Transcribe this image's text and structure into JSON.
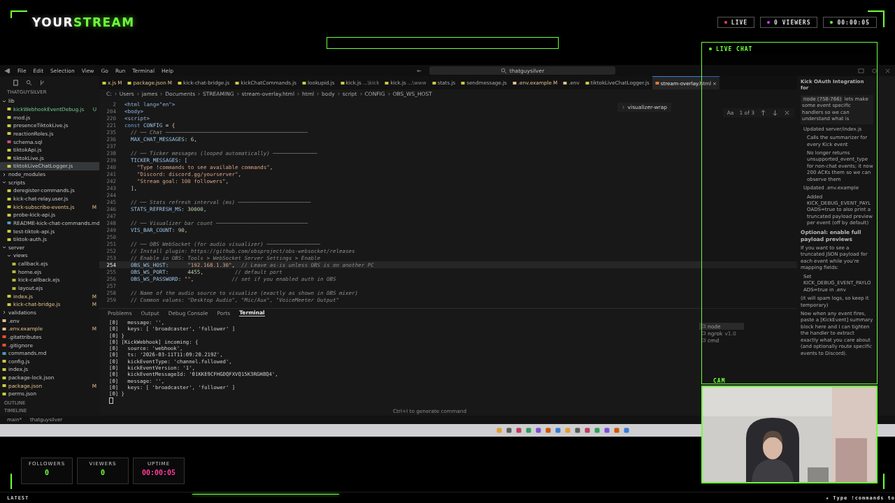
{
  "logo": {
    "parts": [
      {
        "text": "YOUR",
        "accent": false
      },
      {
        "text": "STREAM",
        "accent": true
      }
    ]
  },
  "status_pills": [
    {
      "label": "LIVE",
      "color": "#ff3b5c"
    },
    {
      "label": "0  VIEWERS",
      "color": "#d63cff"
    },
    {
      "label": "00:00:05",
      "color": "#6dff3a"
    }
  ],
  "editor": {
    "menu": [
      "File",
      "Edit",
      "Selection",
      "View",
      "Go",
      "Run",
      "Terminal",
      "Help"
    ],
    "command_center": "thatguysilver",
    "explorer_title": "THATGUYSILVER",
    "tree": [
      {
        "name": "lib",
        "kind": "folder",
        "expanded": true,
        "selected": false,
        "children": [
          {
            "name": "kickWebhookEventDebug.js",
            "kind": "js",
            "badge": "U",
            "modified": false,
            "selected": false
          },
          {
            "name": "mod.js",
            "kind": "js",
            "selected": false
          },
          {
            "name": "presenceTiktokLive.js",
            "kind": "js",
            "selected": false
          },
          {
            "name": "reactionRoles.js",
            "kind": "js",
            "selected": false
          },
          {
            "name": "schema.sql",
            "kind": "sql",
            "selected": false
          },
          {
            "name": "tiktokApi.js",
            "kind": "js",
            "selected": false
          },
          {
            "name": "tiktokLive.js",
            "kind": "js",
            "selected": false
          },
          {
            "name": "tiktokLiveChatLogger.js",
            "kind": "js",
            "selected": true
          }
        ]
      },
      {
        "name": "node_modules",
        "kind": "folder",
        "expanded": false,
        "selected": false
      },
      {
        "name": "scripts",
        "kind": "folder",
        "expanded": true,
        "selected": false,
        "children": [
          {
            "name": "deregister-commands.js",
            "kind": "js",
            "selected": false
          },
          {
            "name": "kick-chat-relay.user.js",
            "kind": "js",
            "selected": false
          },
          {
            "name": "kick-subscribe-events.js",
            "kind": "js",
            "badge": "M",
            "modified": true,
            "selected": false
          },
          {
            "name": "probe-kick-api.js",
            "kind": "js",
            "selected": false
          },
          {
            "name": "README-kick-chat-commands.md",
            "kind": "md",
            "selected": false
          },
          {
            "name": "test-tiktok-api.js",
            "kind": "js",
            "selected": false
          },
          {
            "name": "tiktok-auth.js",
            "kind": "js",
            "selected": false
          }
        ]
      },
      {
        "name": "server",
        "kind": "folder",
        "expanded": true,
        "selected": false,
        "children": [
          {
            "name": "views",
            "kind": "folder",
            "expanded": true,
            "selected": false,
            "children": [
              {
                "name": "callback.ejs",
                "kind": "ejs",
                "selected": false
              },
              {
                "name": "home.ejs",
                "kind": "ejs",
                "selected": false
              },
              {
                "name": "kick-callback.ejs",
                "kind": "ejs",
                "selected": false
              },
              {
                "name": "layout.ejs",
                "kind": "ejs",
                "selected": false
              }
            ]
          },
          {
            "name": "index.js",
            "kind": "js",
            "badge": "M",
            "modified": true,
            "selected": false
          },
          {
            "name": "kick-chat-bridge.js",
            "kind": "js",
            "badge": "M",
            "modified": true,
            "selected": false
          }
        ]
      },
      {
        "name": "validations",
        "kind": "folder",
        "expanded": false,
        "selected": false
      },
      {
        "name": ".env",
        "kind": "env",
        "selected": false
      },
      {
        "name": ".env.example",
        "kind": "env",
        "badge": "M",
        "modified": true,
        "selected": false
      },
      {
        "name": ".gitattributes",
        "kind": "git",
        "selected": false
      },
      {
        "name": ".gitignore",
        "kind": "git",
        "selected": false
      },
      {
        "name": "commands.md",
        "kind": "md",
        "selected": false
      },
      {
        "name": "config.js",
        "kind": "js",
        "selected": false
      },
      {
        "name": "index.js",
        "kind": "js",
        "selected": false
      },
      {
        "name": "package-lock.json",
        "kind": "json",
        "selected": false
      },
      {
        "name": "package.json",
        "kind": "json",
        "badge": "M",
        "modified": true,
        "selected": false
      },
      {
        "name": "perms.json",
        "kind": "json",
        "selected": false
      }
    ],
    "sections": [
      "OUTLINE",
      "TIMELINE"
    ],
    "tabs": [
      {
        "label": "x.js",
        "badge": "M",
        "kind": "js",
        "modified": true,
        "selected": false
      },
      {
        "label": "package.json",
        "badge": "M",
        "kind": "json",
        "modified": true,
        "selected": false
      },
      {
        "label": "kick-chat-bridge.js",
        "kind": "js",
        "selected": false
      },
      {
        "label": "kickChatCommands.js",
        "kind": "js",
        "selected": false
      },
      {
        "label": "lookupid.js",
        "kind": "js",
        "selected": false
      },
      {
        "label": "kick.js",
        "hint": "...\\kick",
        "kind": "js",
        "selected": false
      },
      {
        "label": "kick.js",
        "hint": "...\\www",
        "kind": "js",
        "selected": false
      },
      {
        "label": "stats.js",
        "kind": "js",
        "selected": false
      },
      {
        "label": "sendmessage.js",
        "kind": "js",
        "selected": false
      },
      {
        "label": ".env.example",
        "badge": "M",
        "kind": "env",
        "modified": true,
        "selected": false
      },
      {
        "label": ".env",
        "kind": "env",
        "selected": false
      },
      {
        "label": "tiktokLiveChatLogger.js",
        "kind": "js",
        "selected": false
      },
      {
        "label": "stream-overlay.html",
        "kind": "html",
        "selected": true,
        "close": "×"
      }
    ],
    "breadcrumb": [
      "C:",
      "Users",
      "james",
      "Documents",
      "STREAMING",
      "stream-overlay.html",
      "html",
      "body",
      "script",
      "CONFIG",
      "OBS_WS_HOST"
    ],
    "sticky": "visualizer-wrap",
    "find": {
      "case": "Aa",
      "count": "1 of 3"
    },
    "code": [
      {
        "number": "2",
        "current": false,
        "tokens": [
          {
            "text": "<html lang=\"en\">",
            "kind": "tag"
          }
        ]
      },
      {
        "number": "204",
        "current": false,
        "tokens": [
          {
            "text": "<body>",
            "kind": "tag"
          }
        ]
      },
      {
        "number": "220",
        "current": false,
        "tokens": [
          {
            "text": "<script>",
            "kind": "tag"
          }
        ]
      },
      {
        "number": "221",
        "current": false,
        "tokens": [
          {
            "text": "const ",
            "kind": "kw"
          },
          {
            "text": "CONFIG",
            "kind": "key"
          },
          {
            "text": " = {",
            "kind": "plain"
          }
        ]
      },
      {
        "number": "235",
        "current": false,
        "tokens": [
          {
            "text": "  // ── Chat ─────────────────────────────────────────────",
            "kind": "cmt"
          }
        ]
      },
      {
        "number": "236",
        "current": false,
        "tokens": [
          {
            "text": "  MAX_CHAT_MESSAGES: ",
            "kind": "key"
          },
          {
            "text": "6",
            "kind": "num"
          },
          {
            "text": ",",
            "kind": "plain"
          }
        ]
      },
      {
        "number": "237",
        "current": false
      },
      {
        "number": "238",
        "current": false,
        "tokens": [
          {
            "text": "  // ── Ticker messages (looped automatically) ──────────────",
            "kind": "cmt"
          }
        ]
      },
      {
        "number": "239",
        "current": false,
        "tokens": [
          {
            "text": "  TICKER_MESSAGES: [",
            "kind": "key"
          }
        ]
      },
      {
        "number": "240",
        "current": false,
        "tokens": [
          {
            "text": "    \"Type !commands to see available commands\"",
            "kind": "str"
          },
          {
            "text": ",",
            "kind": "plain"
          }
        ]
      },
      {
        "number": "241",
        "current": false,
        "tokens": [
          {
            "text": "    \"Discord: discord.gg/yourserver\"",
            "kind": "str"
          },
          {
            "text": ",",
            "kind": "plain"
          }
        ]
      },
      {
        "number": "242",
        "current": false,
        "tokens": [
          {
            "text": "    \"Stream goal: 100 followers\"",
            "kind": "str"
          },
          {
            "text": ",",
            "kind": "plain"
          }
        ]
      },
      {
        "number": "243",
        "current": false,
        "tokens": [
          {
            "text": "  ],",
            "kind": "plain"
          }
        ]
      },
      {
        "number": "244",
        "current": false
      },
      {
        "number": "245",
        "current": false,
        "tokens": [
          {
            "text": "  // ── Stats refresh interval (ms) ───────────────────────",
            "kind": "cmt"
          }
        ]
      },
      {
        "number": "246",
        "current": false,
        "tokens": [
          {
            "text": "  STATS_REFRESH_MS: ",
            "kind": "key"
          },
          {
            "text": "30000",
            "kind": "num"
          },
          {
            "text": ",",
            "kind": "plain"
          }
        ]
      },
      {
        "number": "247",
        "current": false
      },
      {
        "number": "248",
        "current": false,
        "tokens": [
          {
            "text": "  // ── Visualizer bar count ─────────────────────────────",
            "kind": "cmt"
          }
        ]
      },
      {
        "number": "249",
        "current": false,
        "tokens": [
          {
            "text": "  VIS_BAR_COUNT: ",
            "kind": "key"
          },
          {
            "text": "90",
            "kind": "num"
          },
          {
            "text": ",",
            "kind": "plain"
          }
        ]
      },
      {
        "number": "250",
        "current": false
      },
      {
        "number": "251",
        "current": false,
        "tokens": [
          {
            "text": "  // ── OBS WebSocket (for audio visualizer) ─────────────────",
            "kind": "cmt"
          }
        ]
      },
      {
        "number": "252",
        "current": false,
        "tokens": [
          {
            "text": "  // Install plugin: https://github.com/obsproject/obs-websocket/releases",
            "kind": "cmt"
          }
        ]
      },
      {
        "number": "253",
        "current": false,
        "tokens": [
          {
            "text": "  // Enable in OBS: Tools > WebSocket Server Settings > Enable",
            "kind": "cmt"
          }
        ]
      },
      {
        "number": "254",
        "current": true,
        "tokens": [
          {
            "text": "  OBS_WS_HOST:      ",
            "kind": "key"
          },
          {
            "text": "\"192.168.1.30\"",
            "kind": "str"
          },
          {
            "text": ",  ",
            "kind": "plain"
          },
          {
            "text": "// Leave as-is unless OBS is on another PC",
            "kind": "cmt"
          }
        ]
      },
      {
        "number": "255",
        "current": false,
        "tokens": [
          {
            "text": "  OBS_WS_PORT:      ",
            "kind": "key"
          },
          {
            "text": "4455",
            "kind": "num"
          },
          {
            "text": ",          ",
            "kind": "plain"
          },
          {
            "text": "// default port",
            "kind": "cmt"
          }
        ]
      },
      {
        "number": "256",
        "current": false,
        "tokens": [
          {
            "text": "  OBS_WS_PASSWORD: ",
            "kind": "key"
          },
          {
            "text": "\"\"",
            "kind": "str"
          },
          {
            "text": ",            ",
            "kind": "plain"
          },
          {
            "text": "// set if you enabled auth in OBS",
            "kind": "cmt"
          }
        ]
      },
      {
        "number": "257",
        "current": false
      },
      {
        "number": "258",
        "current": false,
        "tokens": [
          {
            "text": "  // Name of the audio source to visualize (exactly as shown in OBS mixer)",
            "kind": "cmt"
          }
        ]
      },
      {
        "number": "259",
        "current": false,
        "tokens": [
          {
            "text": "  // Common values: \"Desktop Audio\", \"Mic/Aux\", \"VoiceMeeter Output\"",
            "kind": "cmt"
          }
        ]
      }
    ],
    "panel_tabs": [
      {
        "label": "Problems",
        "selected": false
      },
      {
        "label": "Output",
        "selected": false
      },
      {
        "label": "Debug Console",
        "selected": false
      },
      {
        "label": "Ports",
        "selected": false
      },
      {
        "label": "Terminal",
        "selected": true
      }
    ],
    "terminal": [
      "[0]   message: '',",
      "[0]   keys: [ 'broadcaster', 'follower' ]",
      "[0] }",
      "[0] [KickWebhook] incoming: {",
      "[0]   source: 'webhook',",
      "[0]   ts: '2026-03-11T11:09:20.219Z',",
      "[0]   kickEventType: 'channel.followed',",
      "[0]   kickEventVersion: '1',",
      "[0]   kickEventMessageId: '01KKE9CFHGDQFXVQ15K3RGH8Q4',",
      "[0]   message: '',",
      "[0]   keys: [ 'broadcaster', 'follower' ]",
      "[0] }"
    ],
    "terminal_hint": "Ctrl+I to generate command",
    "terminals": [
      {
        "name": "node",
        "selected": true
      },
      {
        "name": "ngrok",
        "version": "v1.0",
        "selected": false
      },
      {
        "name": "cmd",
        "selected": false
      }
    ],
    "chat": {
      "title": "Kick OAuth Integration for",
      "messages": [
        {
          "kind": "user",
          "chip": "node (758-766)",
          "text": "lets make some event specific handlers so we can understand what is"
        },
        {
          "kind": "bullet",
          "text": "Updated server/index.js"
        },
        {
          "kind": "subbullet",
          "text": "Calls the summarizer for every Kick event"
        },
        {
          "kind": "subbullet",
          "text": "No longer returns unsupported_event_type for non-chat events; it now 200 ACKs them so we can observe them"
        },
        {
          "kind": "bullet",
          "text": "Updated .env.example"
        },
        {
          "kind": "subbullet",
          "text": "Added KICK_DEBUG_EVENT_PAYLOADS=true to also print a truncated payload preview per event (off by default)"
        },
        {
          "kind": "heading",
          "text": "Optional: enable full payload previews"
        },
        {
          "kind": "para",
          "text": "If you want to see a truncated JSON payload for each event while you're mapping fields:"
        },
        {
          "kind": "bullet",
          "text": "Set KICK_DEBUG_EVENT_PAYLOADS=true in .env"
        },
        {
          "kind": "para",
          "text": "(it will spam logs, so keep it temporary)"
        },
        {
          "kind": "para",
          "text": "Now when any event fires, paste a [KickEvent] summary block here and I can tighten the handler to extract exactly what you care about (and optionally route specific events to Discord)."
        }
      ]
    },
    "status_bar": [
      "main*",
      "thatguysilver"
    ]
  },
  "live_chat": {
    "title": "LIVE CHAT"
  },
  "cam": {
    "label": "CAM",
    "kind": "picture"
  },
  "stats": [
    {
      "label": "FOLLOWERS",
      "value": "0",
      "kind": "count"
    },
    {
      "label": "VIEWERS",
      "value": "0",
      "kind": "count"
    },
    {
      "label": "UPTIME",
      "value": "00:00:05",
      "kind": "time"
    }
  ],
  "ticker": {
    "label": "LATEST",
    "message": "★ Type !commands to"
  }
}
